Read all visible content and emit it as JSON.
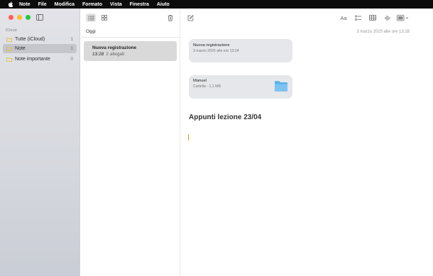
{
  "menubar": {
    "items": [
      "Note",
      "File",
      "Modifica",
      "Formato",
      "Vista",
      "Finestra",
      "Aiuto"
    ]
  },
  "sidebar": {
    "section": "iCloud",
    "items": [
      {
        "label": "Tutte (iCloud)",
        "count": "1"
      },
      {
        "label": "Note",
        "count": "1"
      },
      {
        "label": "Note importante",
        "count": "0"
      }
    ]
  },
  "list": {
    "group_header": "Oggi",
    "notes": [
      {
        "title": "Nuova registrazione",
        "time": "13:28",
        "attachments": "2 allegati"
      }
    ]
  },
  "toolbar": {
    "format_label": "Aa"
  },
  "editor": {
    "date": "3 marzo 2025 alle ore 13:28",
    "attachments": [
      {
        "title": "Nuova registrazione",
        "subtitle": "3 marzo 2025 alle ore 13:24"
      },
      {
        "title": "Manuel",
        "subtitle": "Cartella · 1,1 MB"
      }
    ],
    "heading": "Appunti lezione 23/04"
  },
  "colors": {
    "close": "#ff5f57",
    "minimize": "#febc2e",
    "zoom": "#28c840",
    "folder": "#e7b82d",
    "selected_row": "#d9d9d9",
    "cursor": "#c8a400"
  },
  "icons": [
    "apple-icon",
    "sidebar-toggle-icon",
    "list-view-icon",
    "gallery-view-icon",
    "trash-icon",
    "compose-icon",
    "format-icon",
    "checklist-icon",
    "table-icon",
    "audio-icon",
    "media-icon",
    "folder-icon"
  ]
}
